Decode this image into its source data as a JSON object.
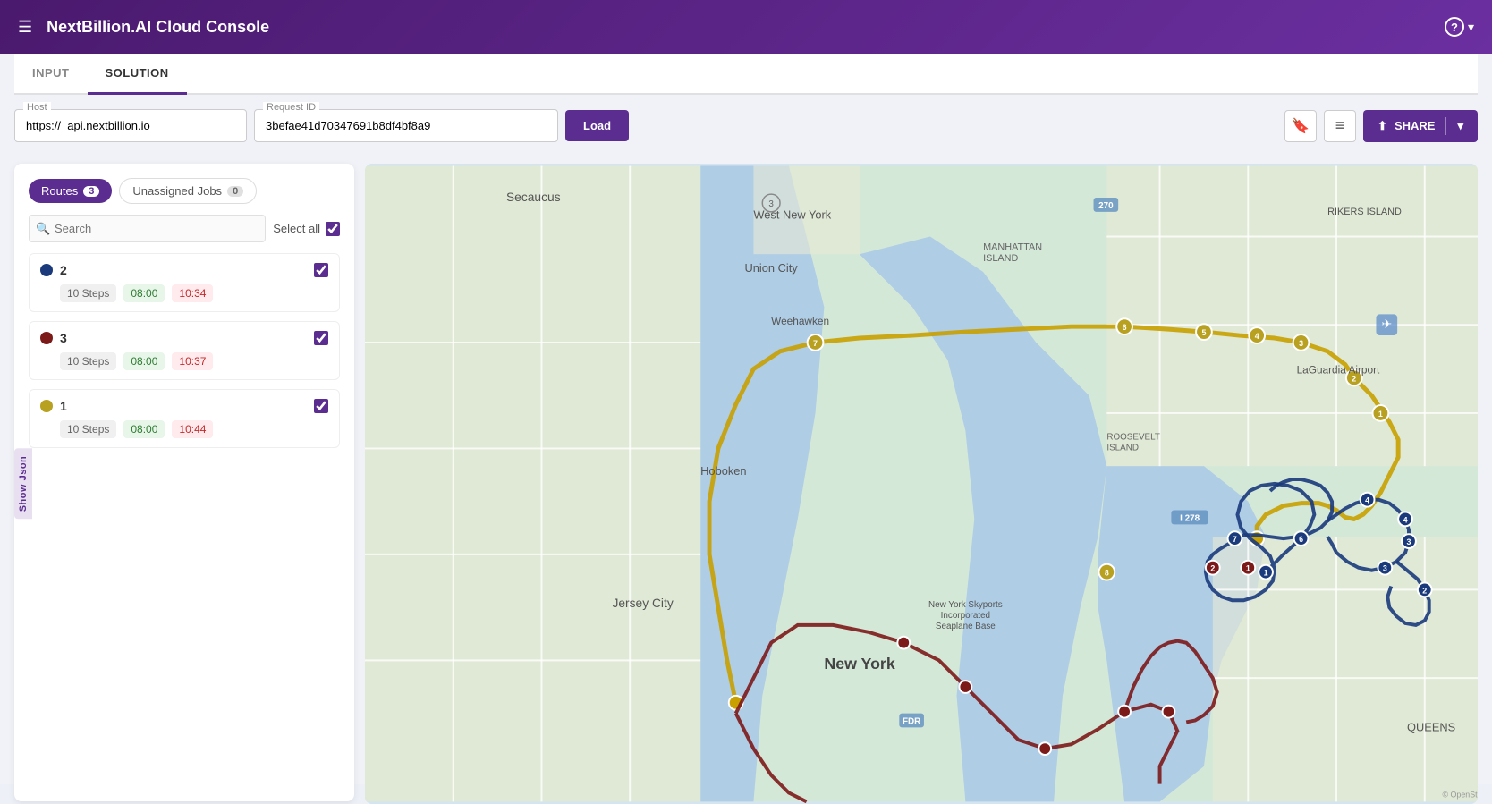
{
  "app": {
    "title": "NextBillion.AI Cloud Console",
    "nav": {
      "menu_icon": "☰",
      "help_icon": "?",
      "help_label": "Help",
      "dropdown_icon": "▾"
    }
  },
  "tabs": {
    "input_label": "INPUT",
    "solution_label": "SOLUTION",
    "active": "SOLUTION"
  },
  "toolbar": {
    "host_label": "Host",
    "host_value": "https://  api.nextbillion.io",
    "request_id_label": "Request ID",
    "request_id_value": "3befae41d70347691b8df4bf8a9",
    "load_label": "Load",
    "bookmark_icon": "🔖",
    "list_icon": "≡",
    "share_label": "SHARE",
    "share_icon": "⬆"
  },
  "panel": {
    "routes_tab_label": "Routes",
    "routes_count": "3",
    "unassigned_tab_label": "Unassigned Jobs",
    "unassigned_count": "0",
    "search_placeholder": "Search",
    "select_all_label": "Select all",
    "show_json_label": "Show Json"
  },
  "routes": [
    {
      "id": "2",
      "dot_color": "#1a3a7c",
      "steps": "10 Steps",
      "start_time": "08:00",
      "end_time": "10:34",
      "checked": true
    },
    {
      "id": "3",
      "dot_color": "#7c1a1a",
      "steps": "10 Steps",
      "start_time": "08:00",
      "end_time": "10:37",
      "checked": true
    },
    {
      "id": "1",
      "dot_color": "#b8a020",
      "steps": "10 Steps",
      "start_time": "08:00",
      "end_time": "10:44",
      "checked": true
    }
  ],
  "map": {
    "locations": {
      "secaucus": "Secaucus",
      "west_new_york": "West New York",
      "union_city": "Union City",
      "weehawken": "Weehawken",
      "hoboken": "Hoboken",
      "jersey_city": "Jersey City",
      "new_york": "New York",
      "manhattan_island": "MANHATTAN ISLAND",
      "roosevelt_island": "ROOSEVELT ISLAND",
      "laguardia": "LaGuardia Airport",
      "rikers_island": "RIKERS ISLAND",
      "queens": "QUEENS",
      "ny_skyports": "New York Skyports Incorporated Seaplane Base",
      "fdr": "FDR"
    }
  }
}
